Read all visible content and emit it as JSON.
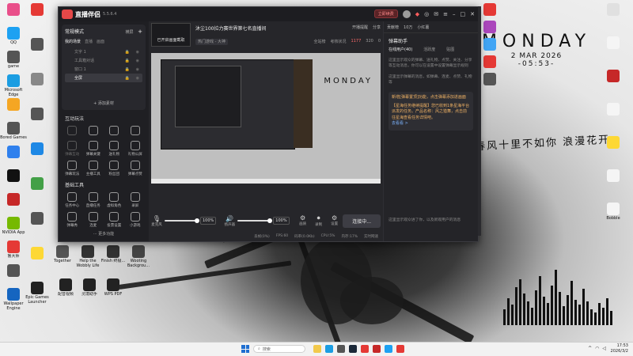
{
  "wallpaper": {
    "day": "MONDAY",
    "date": "2 MAR 2026",
    "time": "-05:53-",
    "calligraphy": "春风十里不如你 浪漫花开"
  },
  "desktop_icons_left": [
    {
      "label": "",
      "color": "#e94f8a"
    },
    {
      "label": "QQ",
      "color": "#1da1f2"
    },
    {
      "label": "game",
      "color": "#555"
    },
    {
      "label": "Microsoft Edge",
      "color": "#1b9de2"
    },
    {
      "label": "",
      "color": "#f5a623"
    },
    {
      "label": "Bored Games",
      "color": "#555"
    },
    {
      "label": "",
      "color": "#2f80ed"
    },
    {
      "label": "",
      "color": "#111"
    },
    {
      "label": "",
      "color": "#c62828"
    },
    {
      "label": "NVIDIA App",
      "color": "#76b900"
    },
    {
      "label": "鲁大师",
      "color": "#e53935"
    },
    {
      "label": "",
      "color": "#555"
    },
    {
      "label": "Wallpaper Engine",
      "color": "#1565c0"
    }
  ],
  "desktop_icons_col2": [
    {
      "label": "",
      "color": "#e53935"
    },
    {
      "label": "",
      "color": "#555"
    },
    {
      "label": "",
      "color": "#888"
    },
    {
      "label": "",
      "color": "#555"
    },
    {
      "label": "",
      "color": "#1e88e5"
    },
    {
      "label": "",
      "color": "#43a047"
    },
    {
      "label": "",
      "color": "#555"
    },
    {
      "label": "",
      "color": "#fdd835"
    },
    {
      "label": "Epic Games Launcher",
      "color": "#222"
    }
  ],
  "desktop_icons_right": [
    {
      "label": "",
      "color": "#e53935"
    },
    {
      "label": "",
      "color": "#ab47bc"
    },
    {
      "label": "",
      "color": "#42a5f5"
    },
    {
      "label": "",
      "color": "#e53935"
    },
    {
      "label": "",
      "color": "#555"
    }
  ],
  "desktop_icons_farright": [
    {
      "label": "",
      "color": "#e0e0e0"
    },
    {
      "label": "",
      "color": "#f5f5f5"
    },
    {
      "label": "",
      "color": "#c62828"
    },
    {
      "label": "",
      "color": "#f5f5f5"
    },
    {
      "label": "",
      "color": "#fdd835"
    },
    {
      "label": "",
      "color": "#f5f5f5"
    },
    {
      "label": "Bobble",
      "color": "#f5f5f5"
    }
  ],
  "desktop_icons_bottom_mid": [
    {
      "label": "Together",
      "color": "#555"
    },
    {
      "label": "Help the Wobbly Life",
      "color": "#333"
    },
    {
      "label": "Finish 终极...",
      "color": "#333"
    },
    {
      "label": "Wooting Backgrou...",
      "color": "#444"
    },
    {
      "label": "配音视频",
      "color": "#222"
    },
    {
      "label": "灵境助手",
      "color": "#222"
    },
    {
      "label": "WPS PDF",
      "color": "#222"
    }
  ],
  "app": {
    "name": "直播伴侣",
    "version": "5.5.6.4",
    "upgrade_label": "立即续费",
    "titlebar_icons": [
      "gift-icon",
      "headset-icon",
      "mail-icon",
      "menu-icon",
      "minimize-icon",
      "maximize-icon",
      "close-icon"
    ]
  },
  "left": {
    "mode_label": "常规模式",
    "mode_right": "横屏",
    "add_label": "+",
    "scene_tabs": [
      "我的场景",
      "直播",
      "画面"
    ],
    "scenes": [
      {
        "label": "文字 1",
        "selected": false
      },
      {
        "label": "工具箱对话",
        "selected": false
      },
      {
        "label": "窗口 1",
        "selected": false
      },
      {
        "label": "全屏",
        "selected": true
      }
    ],
    "add_source": "+ 添加素材",
    "interactive_title": "互动玩法",
    "interactive_tools": [
      {
        "label": "",
        "dim": true
      },
      {
        "label": "",
        "dim": false
      },
      {
        "label": "",
        "dim": false
      },
      {
        "label": "",
        "dim": false
      },
      {
        "label": "弹幕互动",
        "dim": true
      },
      {
        "label": "弹幕关键",
        "dim": false
      },
      {
        "label": "送礼物",
        "dim": false
      },
      {
        "label": "礼物公屏",
        "dim": false
      },
      {
        "label": "弹幕玩法",
        "dim": false
      },
      {
        "label": "主播工具",
        "dim": false
      },
      {
        "label": "粉丝团",
        "dim": false
      },
      {
        "label": "弹幕点赞",
        "dim": false
      }
    ],
    "basic_title": "基础工具",
    "basic_tools": [
      {
        "label": "任务中心"
      },
      {
        "label": "直播任务"
      },
      {
        "label": "虚拟角色"
      },
      {
        "label": "录屏"
      },
      {
        "label": "弹幕秀"
      },
      {
        "label": "连麦"
      },
      {
        "label": "投票设置"
      },
      {
        "label": "小游戏"
      }
    ],
    "more_tools": "更多功能"
  },
  "center": {
    "cover_label": "已开启画面截取",
    "title": "沐尘100拉力赛世界第七名直播间",
    "category": "热门游戏 - 大神",
    "head_buttons": [
      "开播提醒",
      "分享"
    ],
    "stats": [
      {
        "label": "全站榜",
        "hot": false
      },
      {
        "label": "考核状况",
        "hot": false
      },
      {
        "label": "1177",
        "hot": true
      },
      {
        "label": "320",
        "hot": false
      },
      {
        "label": "0",
        "hot": false
      }
    ],
    "preview_text": "MONDAY",
    "mic_label": "麦克风",
    "mic_pct": "100%",
    "speaker_label": "扬声器",
    "speaker_pct": "100%",
    "extra_controls": [
      "画质",
      "录制",
      "设置"
    ],
    "connect_label": "连接中...",
    "status": [
      "丢帧(0%)",
      "FPS:60",
      "码率(0.0Kb)",
      "CPU:5%",
      "内存:17%",
      "实时网速"
    ]
  },
  "right": {
    "top_tabs": [
      "贡献榜",
      "10万",
      "小红薯"
    ],
    "panel_title": "弹幕助手",
    "tabs": [
      {
        "label": "在线用户(40)",
        "active": true
      },
      {
        "label": "活跃度",
        "active": false
      },
      {
        "label": "贴图",
        "active": false
      }
    ],
    "messages": [
      "这里显示观众的弹幕、送礼物、点赞、关注、分享等互动消息，你可以在设置中设置弹幕显示规则",
      "这里显示弹幕的消息，如弹幕、连麦、点赞、礼物等"
    ],
    "notice": "新增[弹幕置顶]功能，点击弹幕添加进画面",
    "notice2": "【星海任务继续提醒】您已收到1条星海平台派发的任务。产品名称：风之猎舞，点击前往星海查看任务详情吧。",
    "notice_link": "去看看 >",
    "footer": "这里显示观众进了你，以及新观用户的消息"
  },
  "taskbar": {
    "search_placeholder": "搜索",
    "time": "17:53",
    "date": "2026/3/2",
    "apps": [
      {
        "name": "file-explorer-icon",
        "color": "#f2c94c"
      },
      {
        "name": "edge-icon",
        "color": "#1b9de2"
      },
      {
        "name": "store-icon",
        "color": "#555"
      },
      {
        "name": "steam-icon",
        "color": "#1b2838"
      },
      {
        "name": "wps-icon",
        "color": "#e53935"
      },
      {
        "name": "app-icon",
        "color": "#c62828"
      },
      {
        "name": "qq-icon",
        "color": "#1da1f2"
      },
      {
        "name": "netease-icon",
        "color": "#e53935"
      }
    ]
  }
}
